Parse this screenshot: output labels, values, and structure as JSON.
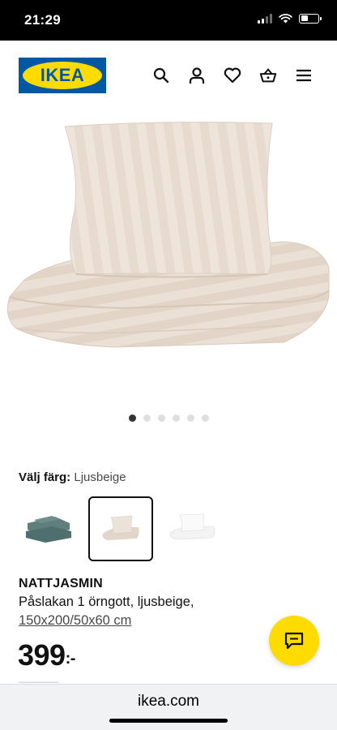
{
  "status_bar": {
    "time": "21:29",
    "icons": [
      "cellular-signal-icon",
      "wifi-icon",
      "battery-icon"
    ]
  },
  "header": {
    "logo_text": "IKEA",
    "nav_icons": [
      "search-icon",
      "user-icon",
      "heart-icon",
      "shopping-basket-icon",
      "menu-icon"
    ]
  },
  "gallery": {
    "image_count": 6,
    "active_index": 0
  },
  "color_picker": {
    "label": "Välj färg:",
    "selected": "Ljusbeige",
    "swatches": [
      "Grönblå",
      "Ljusbeige",
      "Vit"
    ]
  },
  "product": {
    "name": "NATTJASMIN",
    "description": "Påslakan 1 örngott, ljusbeige,",
    "size": "150x200/50x60 cm",
    "price_main": "399",
    "price_suffix": ":-"
  },
  "chat": {
    "icon": "chat-icon"
  },
  "browser": {
    "url": "ikea.com"
  },
  "colors": {
    "ikea_blue": "#0058a3",
    "ikea_yellow": "#ffdb00",
    "text": "#111111"
  }
}
